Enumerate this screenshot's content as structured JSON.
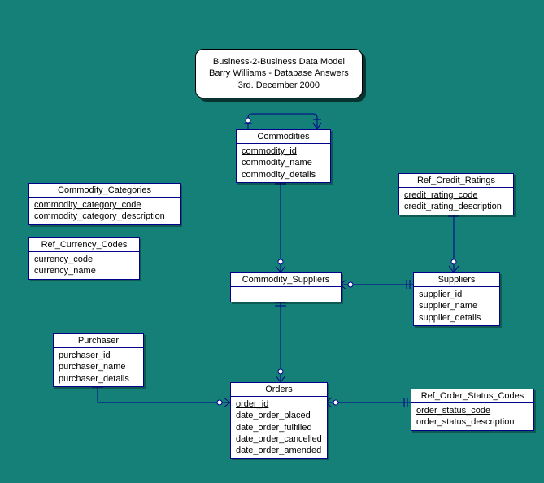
{
  "title": {
    "line1": "Business-2-Business Data Model",
    "line2": "Barry Williams - Database Answers",
    "line3": "3rd. December 2000"
  },
  "entities": {
    "commodities": {
      "name": "Commodities",
      "pk": "commodity_id",
      "attrs": [
        "commodity_name",
        "commodity_details"
      ]
    },
    "commodity_categories": {
      "name": "Commodity_Categories",
      "pk": "commodity_category_code",
      "attrs": [
        "commodity_category_description"
      ]
    },
    "ref_currency_codes": {
      "name": "Ref_Currency_Codes",
      "pk": "currency_code",
      "attrs": [
        "currency_name"
      ]
    },
    "ref_credit_ratings": {
      "name": "Ref_Credit_Ratings",
      "pk": "credit_rating_code",
      "attrs": [
        "credit_rating_description"
      ]
    },
    "commodity_suppliers": {
      "name": "Commodity_Suppliers",
      "pk": "",
      "attrs": []
    },
    "suppliers": {
      "name": "Suppliers",
      "pk": "supplier_id",
      "attrs": [
        "supplier_name",
        "supplier_details"
      ]
    },
    "purchaser": {
      "name": "Purchaser",
      "pk": "purchaser_id",
      "attrs": [
        "purchaser_name",
        "purchaser_details"
      ]
    },
    "orders": {
      "name": "Orders",
      "pk": "order_id",
      "attrs": [
        "date_order_placed",
        "date_order_fulfilled",
        "date_order_cancelled",
        "date_order_amended"
      ]
    },
    "ref_order_status_codes": {
      "name": "Ref_Order_Status_Codes",
      "pk": "order_status_code",
      "attrs": [
        "order_status_description"
      ]
    }
  },
  "chart_data": {
    "type": "erd",
    "title": "Business-2-Business Data Model",
    "author": "Barry Williams - Database Answers",
    "date": "3rd. December 2000",
    "entities": [
      {
        "name": "Commodities",
        "attributes": [
          {
            "name": "commodity_id",
            "pk": true
          },
          {
            "name": "commodity_name"
          },
          {
            "name": "commodity_details"
          }
        ]
      },
      {
        "name": "Commodity_Categories",
        "attributes": [
          {
            "name": "commodity_category_code",
            "pk": true
          },
          {
            "name": "commodity_category_description"
          }
        ]
      },
      {
        "name": "Ref_Currency_Codes",
        "attributes": [
          {
            "name": "currency_code",
            "pk": true
          },
          {
            "name": "currency_name"
          }
        ]
      },
      {
        "name": "Ref_Credit_Ratings",
        "attributes": [
          {
            "name": "credit_rating_code",
            "pk": true
          },
          {
            "name": "credit_rating_description"
          }
        ]
      },
      {
        "name": "Commodity_Suppliers",
        "attributes": []
      },
      {
        "name": "Suppliers",
        "attributes": [
          {
            "name": "supplier_id",
            "pk": true
          },
          {
            "name": "supplier_name"
          },
          {
            "name": "supplier_details"
          }
        ]
      },
      {
        "name": "Purchaser",
        "attributes": [
          {
            "name": "purchaser_id",
            "pk": true
          },
          {
            "name": "purchaser_name"
          },
          {
            "name": "purchaser_details"
          }
        ]
      },
      {
        "name": "Orders",
        "attributes": [
          {
            "name": "order_id",
            "pk": true
          },
          {
            "name": "date_order_placed"
          },
          {
            "name": "date_order_fulfilled"
          },
          {
            "name": "date_order_cancelled"
          },
          {
            "name": "date_order_amended"
          }
        ]
      },
      {
        "name": "Ref_Order_Status_Codes",
        "attributes": [
          {
            "name": "order_status_code",
            "pk": true
          },
          {
            "name": "order_status_description"
          }
        ]
      }
    ],
    "relationships": [
      {
        "from": "Commodities",
        "to": "Commodities",
        "type": "self-one-to-many"
      },
      {
        "from": "Commodities",
        "to": "Commodity_Suppliers",
        "type": "one-to-many"
      },
      {
        "from": "Suppliers",
        "to": "Commodity_Suppliers",
        "type": "one-to-many"
      },
      {
        "from": "Ref_Credit_Ratings",
        "to": "Suppliers",
        "type": "one-to-many"
      },
      {
        "from": "Commodity_Suppliers",
        "to": "Orders",
        "type": "one-to-many"
      },
      {
        "from": "Purchaser",
        "to": "Orders",
        "type": "one-to-many"
      },
      {
        "from": "Ref_Order_Status_Codes",
        "to": "Orders",
        "type": "one-to-many"
      }
    ]
  }
}
